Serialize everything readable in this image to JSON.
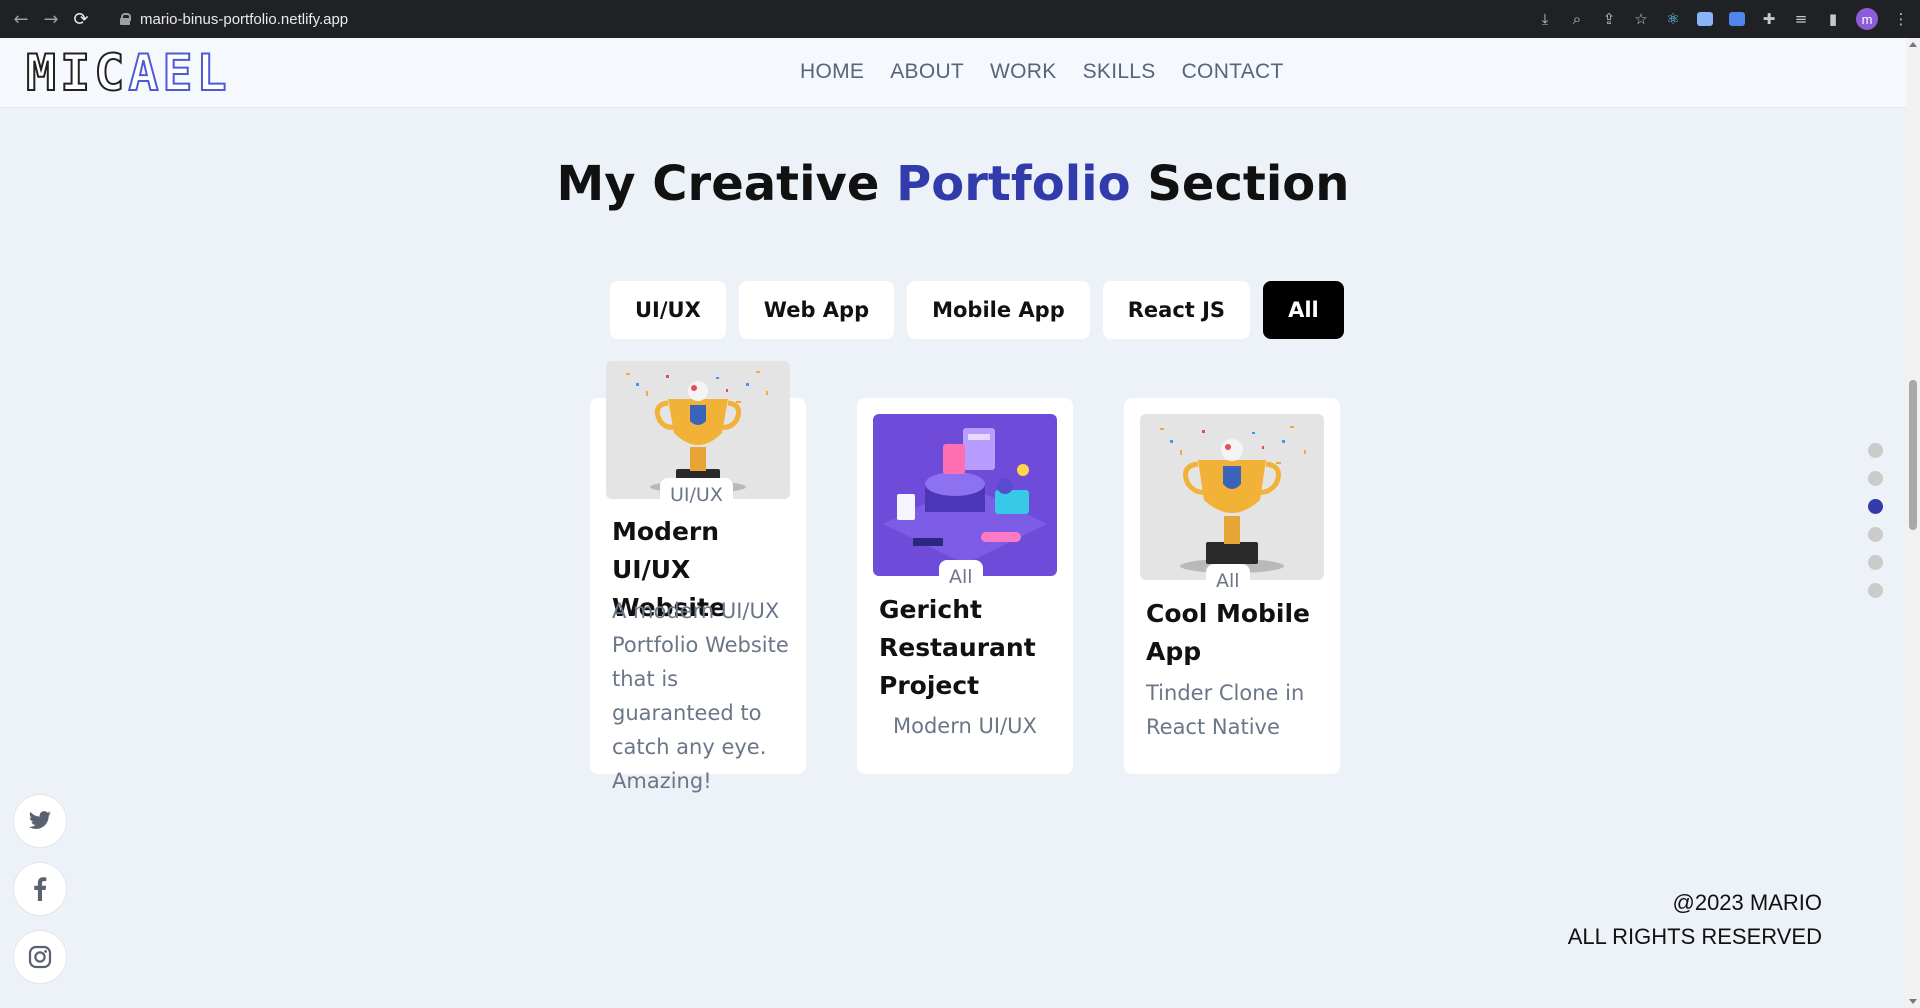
{
  "browser": {
    "url": "mario-binus-portfolio.netlify.app",
    "profile_initial": "m"
  },
  "navbar": {
    "logo_part1": "MIC",
    "logo_part2": "AEL",
    "links": [
      "HOME",
      "ABOUT",
      "WORK",
      "SKILLS",
      "CONTACT"
    ]
  },
  "section": {
    "title_before": "My Creative ",
    "title_accent": "Portfolio",
    "title_after": " Section",
    "accent_color": "#313bac"
  },
  "filters": [
    "UI/UX",
    "Web App",
    "Mobile App",
    "React JS",
    "All"
  ],
  "active_filter": "All",
  "cards": [
    {
      "tag": "UI/UX",
      "title": "Modern UI/UX Website",
      "description": "A modern UI/UX Portfolio Website that is guaranteed to catch any eye. Amazing!",
      "image": "trophy-illustration"
    },
    {
      "tag": "All",
      "title": "Gericht Restaurant Project",
      "description": "Modern UI/UX",
      "image": "isometric-purple-illustration"
    },
    {
      "tag": "All",
      "title": "Cool Mobile App",
      "description": "Tinder Clone in React Native",
      "image": "trophy-illustration"
    }
  ],
  "side_nav": {
    "count": 6,
    "active_index": 2
  },
  "socials": [
    "twitter-icon",
    "facebook-icon",
    "instagram-icon"
  ],
  "footer": {
    "line1": "@2023 MARIO",
    "line2": "ALL RIGHTS RESERVED"
  }
}
